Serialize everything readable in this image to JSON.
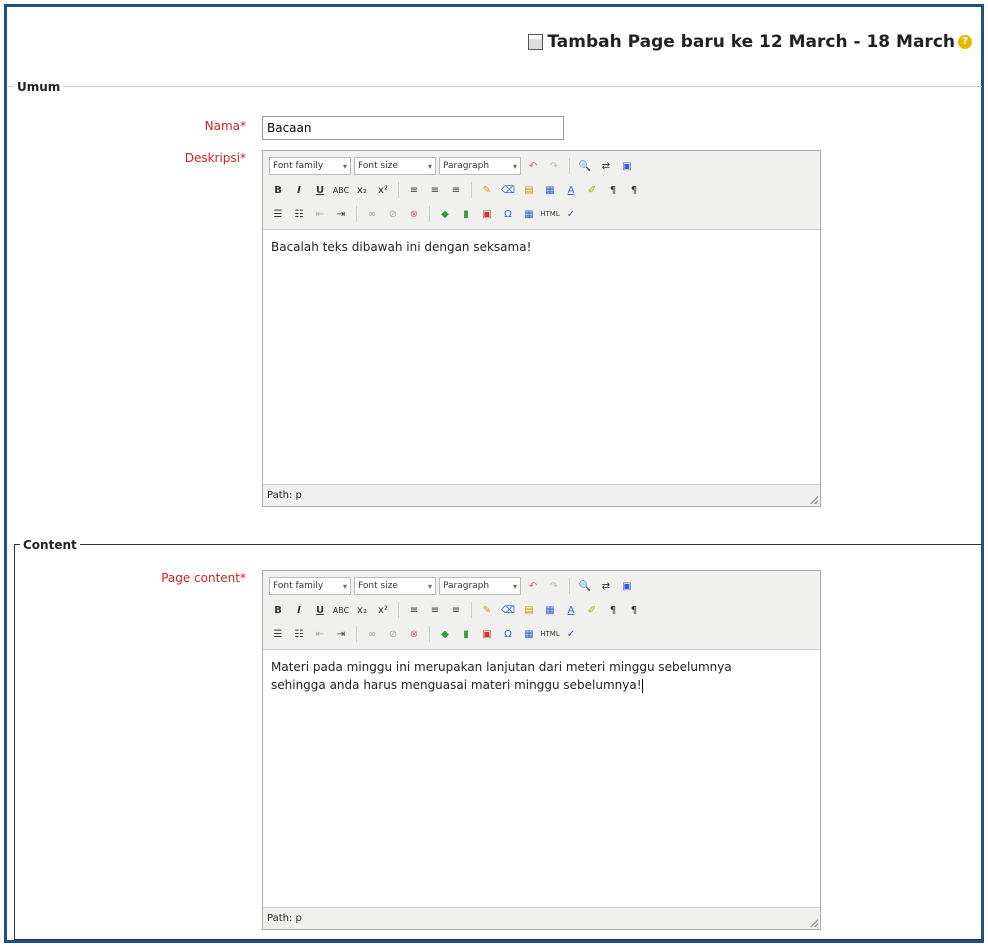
{
  "header": {
    "title": "Tambah Page baru ke 12 March - 18 March",
    "help_icon": "?"
  },
  "umum": {
    "legend": "Umum",
    "nama": {
      "label": "Nama*",
      "value": "Bacaan"
    },
    "deskripsi": {
      "label": "Deskripsi*",
      "toolbar": {
        "font_family": "Font family",
        "font_size": "Font size",
        "format": "Paragraph"
      },
      "content": "Bacalah teks dibawah ini dengan seksama!",
      "status": "Path: p"
    }
  },
  "content_section": {
    "legend": "Content",
    "page_content": {
      "label": "Page content*",
      "toolbar": {
        "font_family": "Font family",
        "font_size": "Font size",
        "format": "Paragraph"
      },
      "line1": "Materi pada minggu ini merupakan lanjutan dari meteri minggu sebelumnya",
      "line2": "sehingga anda harus menguasai materi minggu sebelumnya!",
      "status": "Path: p"
    }
  },
  "colors": {
    "frame": "#1f4e8c",
    "required_label": "#cc2222",
    "toolbar_bg": "#f0f0ee"
  }
}
